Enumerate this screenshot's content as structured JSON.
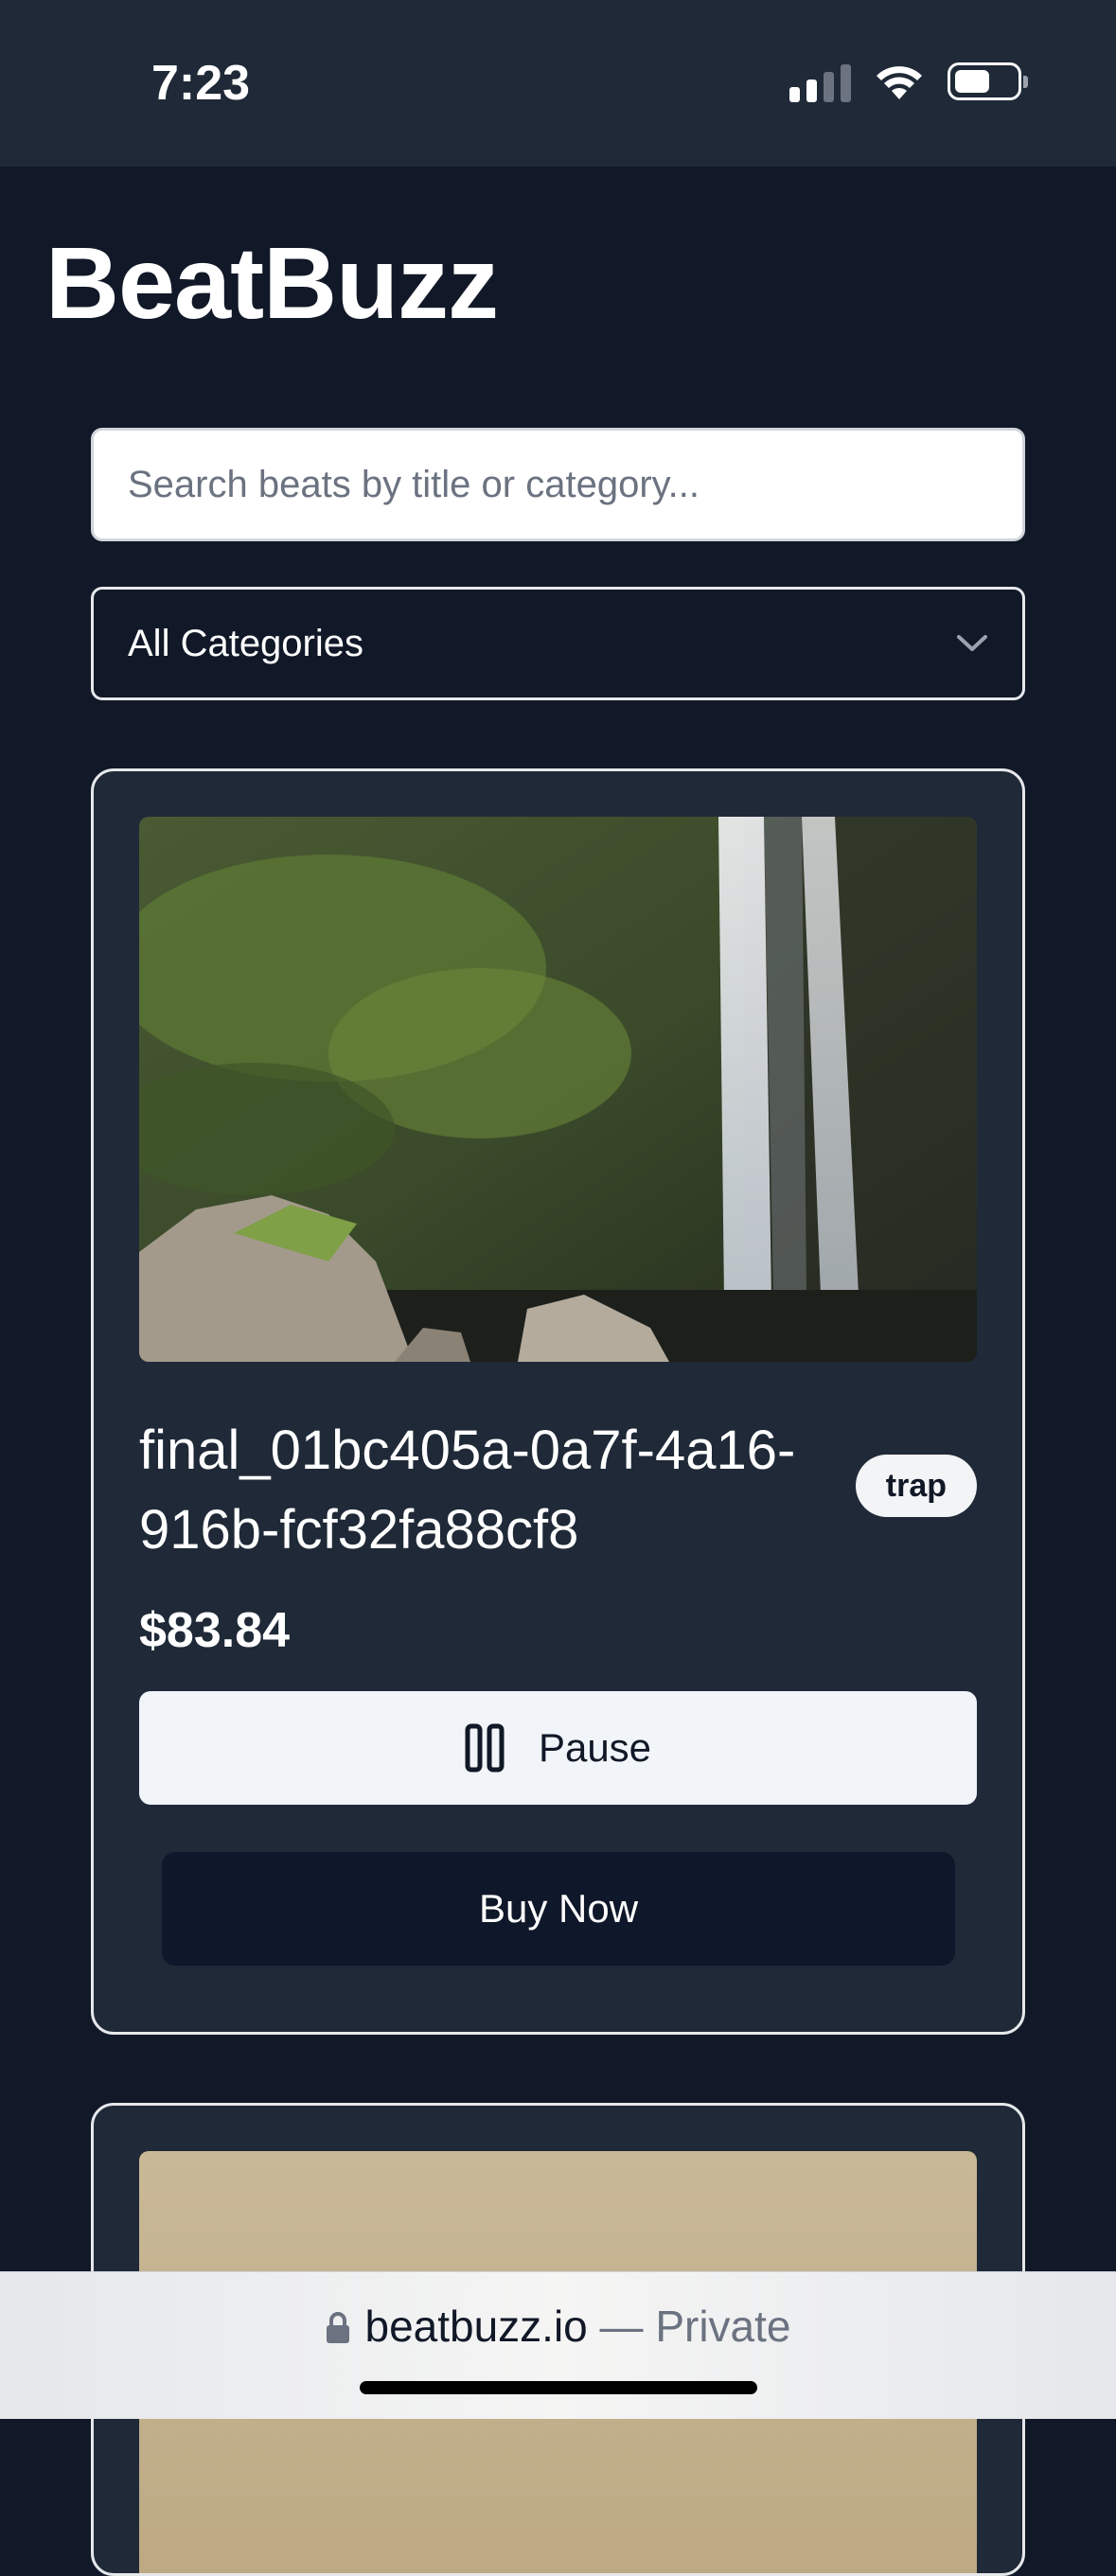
{
  "status_bar": {
    "time": "7:23"
  },
  "app": {
    "title": "BeatBuzz"
  },
  "search": {
    "placeholder": "Search beats by title or category..."
  },
  "category_filter": {
    "selected": "All Categories"
  },
  "beats": [
    {
      "title": "final_01bc405a-0a7f-4a16-916b-fcf32fa88cf8",
      "category": "trap",
      "price": "$83.84",
      "play_label": "Pause",
      "buy_label": "Buy Now"
    }
  ],
  "browser": {
    "domain": "beatbuzz.io",
    "separator": " — ",
    "mode": "Private"
  },
  "icons": {
    "signal": "signal-icon",
    "wifi": "wifi-icon",
    "battery": "battery-icon",
    "chevron": "chevron-down-icon",
    "pause": "pause-icon",
    "lock": "lock-icon"
  }
}
